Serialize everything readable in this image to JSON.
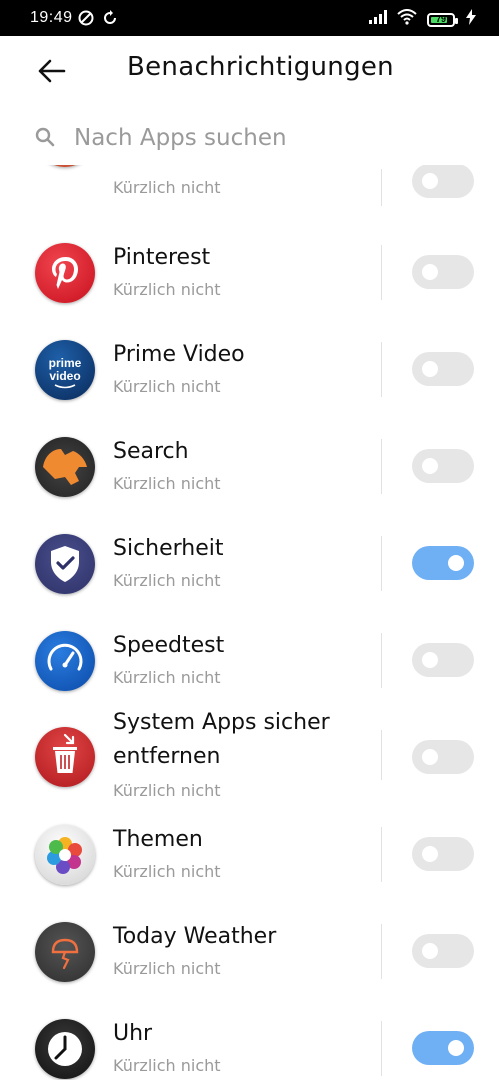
{
  "status_bar": {
    "time": "19:49",
    "battery_level": "79"
  },
  "header": {
    "title": "Benachrichtigungen"
  },
  "search": {
    "placeholder": "Nach Apps suchen"
  },
  "colors": {
    "toggle_on": "#6fb0f5",
    "toggle_off": "#e6e6e6"
  },
  "apps": [
    {
      "name": "",
      "status": "Kürzlich nicht",
      "enabled": false,
      "icon": "partial-app-icon"
    },
    {
      "name": "Pinterest",
      "status": "Kürzlich nicht",
      "enabled": false,
      "icon": "pinterest-icon"
    },
    {
      "name": "Prime Video",
      "status": "Kürzlich nicht",
      "enabled": false,
      "icon": "prime-video-icon"
    },
    {
      "name": "Search",
      "status": "Kürzlich nicht",
      "enabled": false,
      "icon": "search-app-icon"
    },
    {
      "name": "Sicherheit",
      "status": "Kürzlich nicht",
      "enabled": true,
      "icon": "security-shield-icon"
    },
    {
      "name": "Speedtest",
      "status": "Kürzlich nicht",
      "enabled": false,
      "icon": "speedtest-icon"
    },
    {
      "name": "System Apps sicher entfernen",
      "status": "Kürzlich nicht",
      "enabled": false,
      "icon": "trash-app-icon"
    },
    {
      "name": "Themen",
      "status": "Kürzlich nicht",
      "enabled": false,
      "icon": "themes-flower-icon"
    },
    {
      "name": "Today Weather",
      "status": "Kürzlich nicht",
      "enabled": false,
      "icon": "weather-icon"
    },
    {
      "name": "Uhr",
      "status": "Kürzlich nicht",
      "enabled": true,
      "icon": "clock-icon"
    }
  ]
}
